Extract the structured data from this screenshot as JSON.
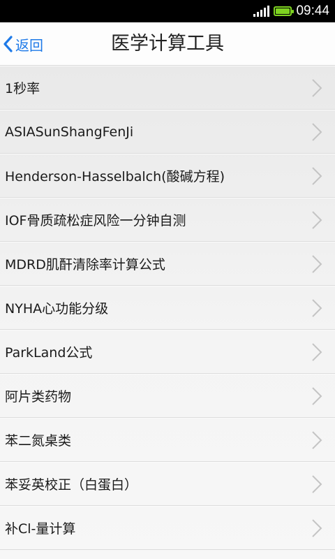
{
  "status_bar": {
    "time": "09:44"
  },
  "nav": {
    "back_label": "返回",
    "title": "医学计算工具"
  },
  "items": [
    {
      "label": "1秒率"
    },
    {
      "label": "ASIASunShangFenJi"
    },
    {
      "label": "Henderson-Hasselbalch(酸碱方程)"
    },
    {
      "label": "IOF骨质疏松症风险一分钟自测"
    },
    {
      "label": "MDRD肌酐清除率计算公式"
    },
    {
      "label": "NYHA心功能分级"
    },
    {
      "label": "ParkLand公式"
    },
    {
      "label": "阿片类药物"
    },
    {
      "label": "苯二氮桌类"
    },
    {
      "label": "苯妥英校正（白蛋白）"
    },
    {
      "label": "补Cl-量计算"
    }
  ],
  "colors": {
    "accent": "#1e7ae8",
    "battery": "#7ed321"
  }
}
